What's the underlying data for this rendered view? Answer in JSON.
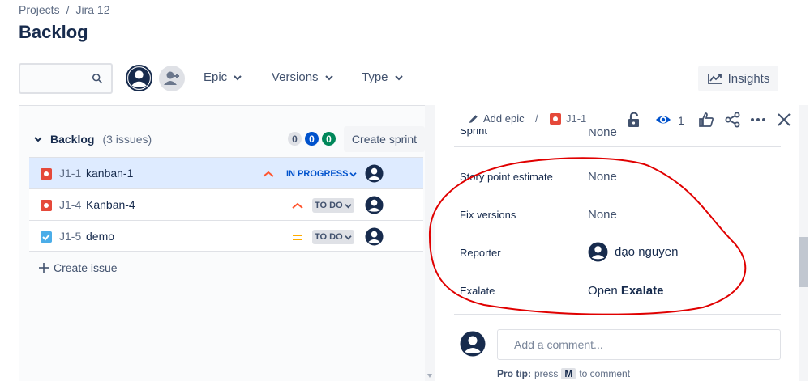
{
  "breadcrumb": {
    "root": "Projects",
    "separator": "/",
    "project": "Jira 12"
  },
  "page": {
    "title": "Backlog"
  },
  "toolbar": {
    "search_value": "",
    "filters": [
      "Epic",
      "Versions",
      "Type"
    ],
    "insights_label": "Insights"
  },
  "backlog": {
    "title": "Backlog",
    "issue_count": "(3 issues)",
    "counts": {
      "todo": "0",
      "in_progress": "0",
      "done": "0"
    },
    "create_sprint_label": "Create sprint",
    "create_issue_label": "Create issue",
    "issues": [
      {
        "key": "J1-1",
        "summary": "kanban-1",
        "type": "bug",
        "status": "IN PROGRESS",
        "priority": "high"
      },
      {
        "key": "J1-4",
        "summary": "Kanban-4",
        "type": "bug",
        "status": "TO DO",
        "priority": "high"
      },
      {
        "key": "J1-5",
        "summary": "demo",
        "type": "task",
        "status": "TO DO",
        "priority": "medium"
      }
    ]
  },
  "detail": {
    "add_epic_label": "Add epic",
    "separator": "/",
    "issue_key": "J1-1",
    "watch_count": "1",
    "fields": {
      "sprint": {
        "label": "Sprint",
        "value": "None"
      },
      "story_points": {
        "label": "Story point estimate",
        "value": "None"
      },
      "fix_versions": {
        "label": "Fix versions",
        "value": "None"
      },
      "reporter": {
        "label": "Reporter",
        "value": "đạo nguyen"
      },
      "exalate": {
        "label": "Exalate",
        "prefix": "Open",
        "value": "Exalate"
      }
    },
    "comment_placeholder": "Add a comment...",
    "pro_tip": {
      "label": "Pro tip:",
      "text_before": "press",
      "key": "M",
      "text_after": "to comment"
    }
  },
  "colors": {
    "primary_text": "#172b4d",
    "link_blue": "#0052cc",
    "bug_red": "#e5493a",
    "task_blue": "#4bade8",
    "priority_high": "#ff5630",
    "priority_medium": "#ffab00",
    "annotation_red": "#e00000"
  }
}
